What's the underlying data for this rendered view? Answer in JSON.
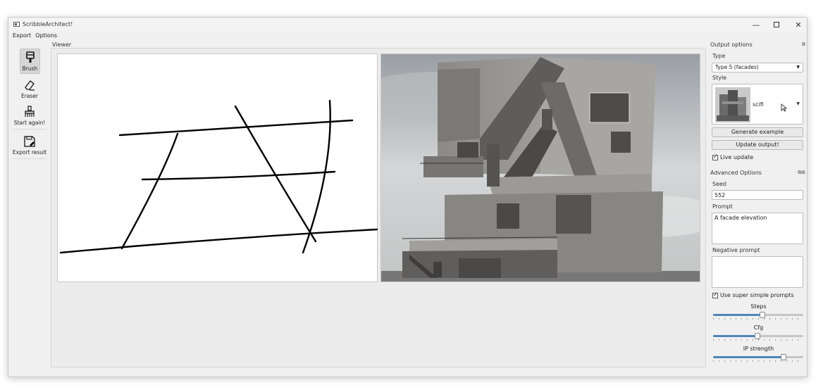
{
  "window": {
    "title": "ScribbleArchitect!"
  },
  "menu": {
    "items": [
      "Export",
      "Options"
    ]
  },
  "toolbar": {
    "brush_label": "Brush",
    "eraser_label": "Eraser",
    "start_again_label": "Start again!",
    "export_label": "Export result"
  },
  "viewer": {
    "label": "Viewer"
  },
  "output_options": {
    "title": "Output options",
    "type_label": "Type",
    "type_value": "Type 5 (facades)",
    "style_label": "Style",
    "style_value": "scifi",
    "generate_button": "Generate example",
    "update_button": "Update output!",
    "live_update_label": "Live update",
    "live_update_checked": true
  },
  "advanced_options": {
    "title": "Advanced Options",
    "seed_label": "Seed",
    "seed_value": "552",
    "prompt_label": "Prompt",
    "prompt_value": "A facade elevation",
    "negative_prompt_label": "Negative prompt",
    "negative_prompt_value": "",
    "simple_prompts_label": "Use super simple prompts",
    "simple_prompts_checked": true,
    "sliders": [
      {
        "label": "Steps",
        "level": 0.55
      },
      {
        "label": "Cfg",
        "level": 0.49
      },
      {
        "label": "IP strength",
        "level": 0.78
      }
    ]
  },
  "colors": {
    "slider_fill": "#4f86b8",
    "window_bg": "#f0f0f0"
  }
}
